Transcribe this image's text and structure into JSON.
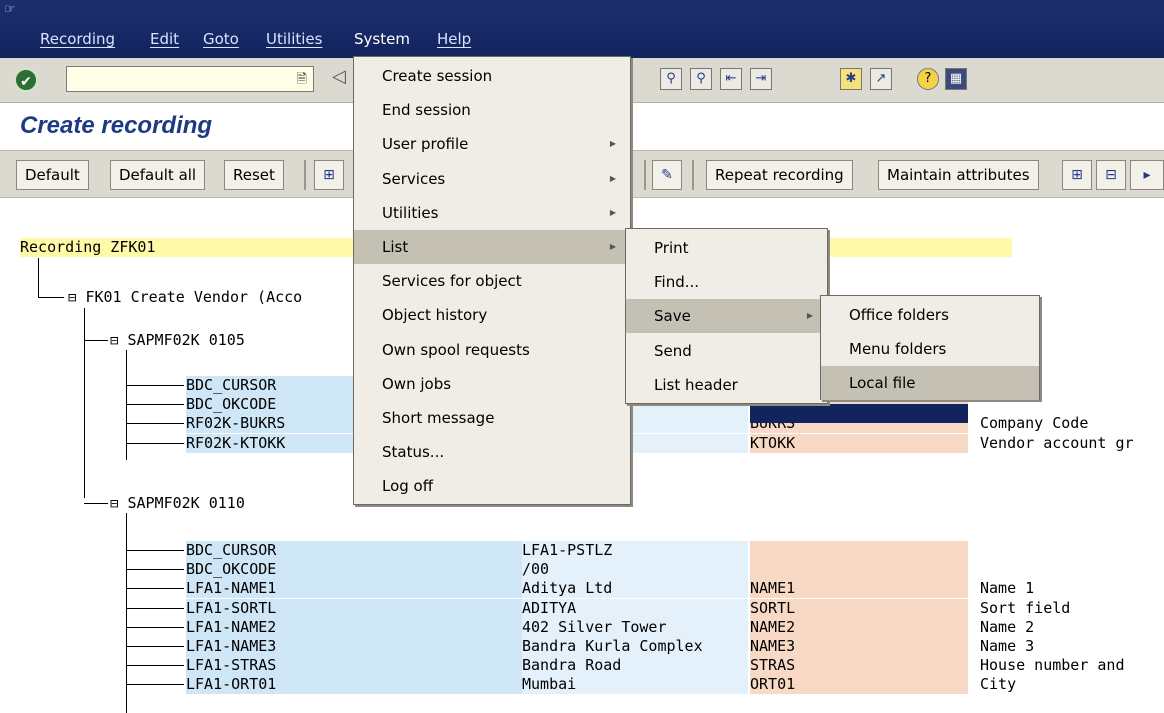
{
  "menubar": {
    "items": [
      "Recording",
      "Edit",
      "Goto",
      "Utilities",
      "System",
      "Help"
    ],
    "active": "System"
  },
  "page": {
    "title": "Create recording"
  },
  "toolbar": {
    "command_value": "",
    "icons": [
      "enter-icon",
      "save-icon",
      "back-icon",
      "find-icon",
      "find-next-icon",
      "first-page-icon",
      "last-page-icon",
      "new-session-icon",
      "shortcut-icon",
      "help-icon",
      "layout-icon"
    ]
  },
  "app_toolbar": {
    "buttons": [
      "Default",
      "Default all",
      "Reset",
      "Repeat recording",
      "Maintain attributes"
    ]
  },
  "system_menu": {
    "items": [
      {
        "label": "Create session",
        "submenu": false
      },
      {
        "label": "End session",
        "submenu": false
      },
      {
        "label": "User profile",
        "submenu": true
      },
      {
        "label": "Services",
        "submenu": true
      },
      {
        "label": "Utilities",
        "submenu": true
      },
      {
        "label": "List",
        "submenu": true,
        "highlighted": true
      },
      {
        "label": "Services for object",
        "submenu": false
      },
      {
        "label": "Object history",
        "submenu": false
      },
      {
        "label": "Own spool requests",
        "submenu": false
      },
      {
        "label": "Own jobs",
        "submenu": false
      },
      {
        "label": "Short message",
        "submenu": false
      },
      {
        "label": "Status...",
        "submenu": false
      },
      {
        "label": "Log off",
        "submenu": false
      }
    ]
  },
  "list_menu": {
    "items": [
      {
        "label": "Print",
        "submenu": false
      },
      {
        "label": "Find...",
        "submenu": false
      },
      {
        "label": "Save",
        "submenu": true,
        "highlighted": true
      },
      {
        "label": "Send",
        "submenu": false
      },
      {
        "label": "List header",
        "submenu": false
      }
    ]
  },
  "save_menu": {
    "items": [
      {
        "label": "Office folders"
      },
      {
        "label": "Menu folders"
      },
      {
        "label": "Local file",
        "highlighted": true
      }
    ]
  },
  "tree": {
    "recording": "Recording ZFK01",
    "transaction": "FK01 Create Vendor (Acco",
    "screen1": {
      "name": "SAPMF02K 0105",
      "rows": [
        {
          "field": "BDC_CURSOR",
          "value": "",
          "key": "",
          "desc": ""
        },
        {
          "field": "BDC_OKCODE",
          "value": "",
          "key": "",
          "desc": ""
        },
        {
          "field": "RF02K-BUKRS",
          "value": "",
          "key": "BUKRS",
          "desc": "Company Code"
        },
        {
          "field": "RF02K-KTOKK",
          "value": "",
          "key": "KTOKK",
          "desc": "Vendor account gr"
        }
      ]
    },
    "screen2": {
      "name": "SAPMF02K 0110",
      "rows": [
        {
          "field": "BDC_CURSOR",
          "value": "LFA1-PSTLZ",
          "key": "",
          "desc": ""
        },
        {
          "field": "BDC_OKCODE",
          "value": "/00",
          "key": "",
          "desc": ""
        },
        {
          "field": "LFA1-NAME1",
          "value": "Aditya Ltd",
          "key": "NAME1",
          "desc": "Name 1"
        },
        {
          "field": "LFA1-SORTL",
          "value": "ADITYA",
          "key": "SORTL",
          "desc": "Sort field"
        },
        {
          "field": "LFA1-NAME2",
          "value": "402 Silver Tower",
          "key": "NAME2",
          "desc": "Name 2"
        },
        {
          "field": "LFA1-NAME3",
          "value": "Bandra Kurla Complex",
          "key": "NAME3",
          "desc": "Name 3"
        },
        {
          "field": "LFA1-STRAS",
          "value": "Bandra Road",
          "key": "STRAS",
          "desc": "House number and"
        },
        {
          "field": "LFA1-ORT01",
          "value": "Mumbai",
          "key": "ORT01",
          "desc": "City"
        }
      ]
    }
  }
}
